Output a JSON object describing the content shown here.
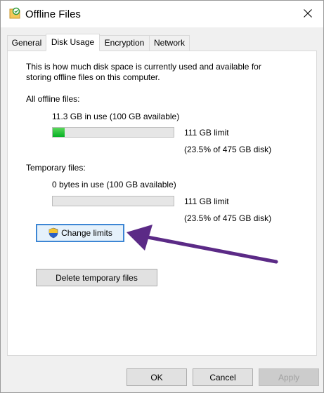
{
  "window": {
    "title": "Offline Files"
  },
  "tabs": [
    {
      "label": "General"
    },
    {
      "label": "Disk Usage"
    },
    {
      "label": "Encryption"
    },
    {
      "label": "Network"
    }
  ],
  "intro": {
    "text_line1": "This is how much disk space is currently used and available for",
    "text_line2": "storing offline files on this computer."
  },
  "all_offline": {
    "heading": "All offline files:",
    "usage": "11.3 GB in use (100 GB available)",
    "limit": "111 GB limit",
    "percent": "(23.5% of 475 GB disk)",
    "fill_fraction": 0.1
  },
  "temporary": {
    "heading": "Temporary files:",
    "usage": "0 bytes in use (100 GB available)",
    "limit": "111 GB limit",
    "percent": "(23.5% of 475 GB disk)",
    "fill_fraction": 0
  },
  "buttons": {
    "change_limits": "Change limits",
    "delete_temp": "Delete temporary files",
    "ok": "OK",
    "cancel": "Cancel",
    "apply": "Apply"
  },
  "colors": {
    "arrow": "#5b2a86",
    "progress": "#06b025",
    "focus": "#3d86d4"
  }
}
